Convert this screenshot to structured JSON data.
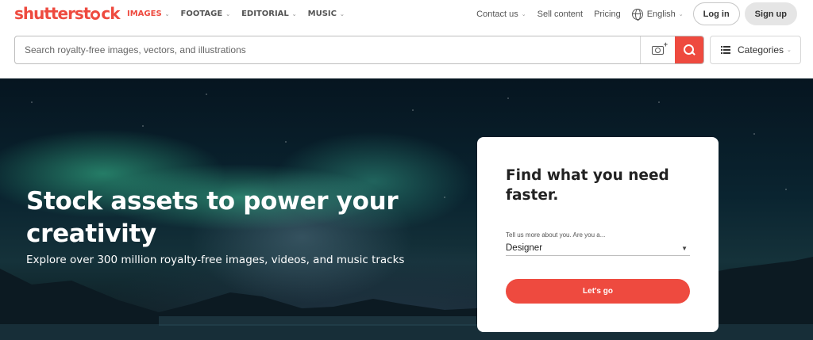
{
  "brand": {
    "logo_prefix": "shutterst",
    "logo_suffix": "ck",
    "accent_color": "#ee4a3f"
  },
  "nav": {
    "items": [
      {
        "label": "IMAGES",
        "active": true
      },
      {
        "label": "FOOTAGE",
        "active": false
      },
      {
        "label": "EDITORIAL",
        "active": false
      },
      {
        "label": "MUSIC",
        "active": false
      }
    ],
    "contact": "Contact us",
    "sell": "Sell content",
    "pricing": "Pricing",
    "language": "English",
    "login": "Log in",
    "signup": "Sign up"
  },
  "search": {
    "placeholder": "Search royalty-free images, vectors, and illustrations",
    "value": "",
    "camera_icon": "camera-plus-icon",
    "search_icon": "search-icon"
  },
  "categories": {
    "label": "Categories",
    "icon": "list-icon"
  },
  "hero": {
    "title": "Stock assets to power your creativity",
    "subtitle": "Explore over 300 million royalty-free images, videos, and music tracks"
  },
  "card": {
    "title": "Find what you need faster.",
    "select_label": "Tell us more about you. Are you a...",
    "select_value": "Designer",
    "button": "Let's go"
  }
}
